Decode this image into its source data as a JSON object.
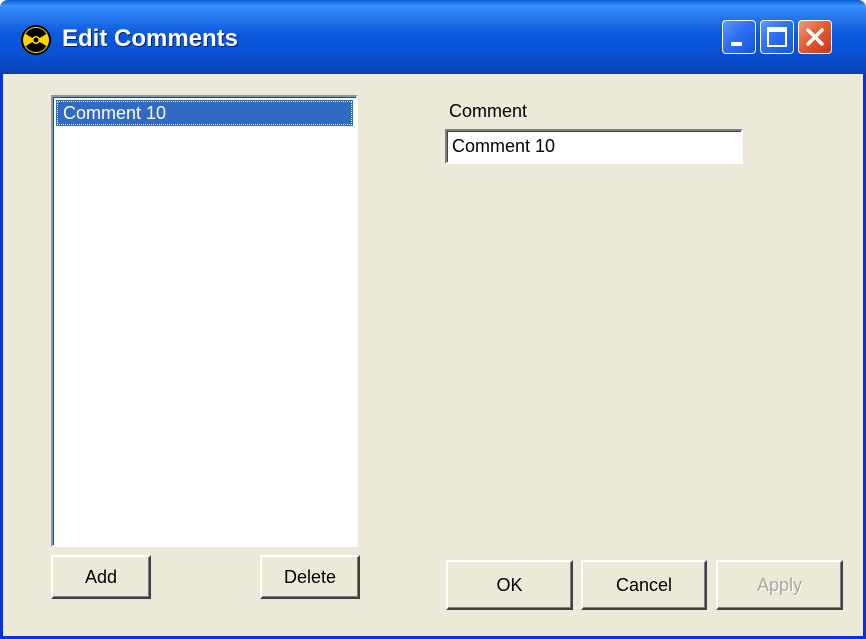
{
  "window": {
    "title": "Edit Comments"
  },
  "titlebar_buttons": {
    "minimize": "minimize-icon",
    "maximize": "maximize-icon",
    "close": "close-icon"
  },
  "comment_list": {
    "items": [
      "Comment 10"
    ],
    "selected_index": 0
  },
  "comment_field": {
    "label": "Comment",
    "value": "Comment 10"
  },
  "buttons": {
    "add": "Add",
    "delete": "Delete",
    "ok": "OK",
    "cancel": "Cancel",
    "apply": "Apply",
    "apply_enabled": false
  },
  "colors": {
    "titlebar": "#0a5fd8",
    "dialog_background": "#ece9d8",
    "selection": "#316ac5",
    "close_button": "#e2582f"
  }
}
